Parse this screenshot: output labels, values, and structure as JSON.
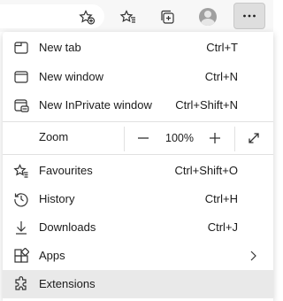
{
  "toolbar": {
    "icons": [
      "add-favorite-icon",
      "favorites-icon",
      "collections-icon",
      "profile-icon",
      "more-icon"
    ]
  },
  "menu": {
    "new_tab": {
      "label": "New tab",
      "shortcut": "Ctrl+T"
    },
    "new_window": {
      "label": "New window",
      "shortcut": "Ctrl+N"
    },
    "new_inprivate": {
      "label": "New InPrivate window",
      "shortcut": "Ctrl+Shift+N"
    },
    "zoom": {
      "label": "Zoom",
      "value": "100%"
    },
    "favourites": {
      "label": "Favourites",
      "shortcut": "Ctrl+Shift+O"
    },
    "history": {
      "label": "History",
      "shortcut": "Ctrl+H"
    },
    "downloads": {
      "label": "Downloads",
      "shortcut": "Ctrl+J"
    },
    "apps": {
      "label": "Apps"
    },
    "extensions": {
      "label": "Extensions"
    }
  },
  "colors": {
    "toolbar_bg": "#f7f7f7",
    "menu_bg": "#ffffff",
    "hover_bg": "#e9e9e9",
    "text": "#1b1b1b"
  }
}
